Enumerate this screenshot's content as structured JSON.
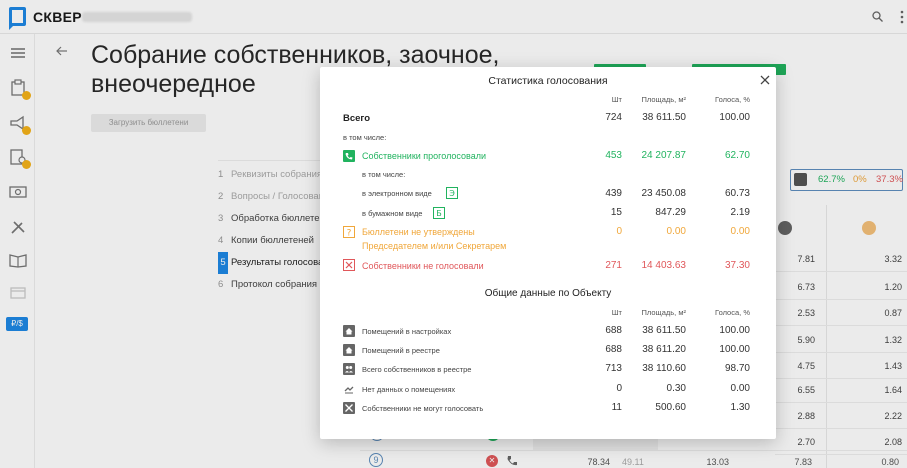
{
  "app": {
    "logo_text": "СКВЕР"
  },
  "page": {
    "title": "Собрание собственников, заочное, внеочередное",
    "upload_button": "Загрузить бюллетени"
  },
  "steps": [
    {
      "num": "1",
      "label": "Реквизиты собрания",
      "state": "muted"
    },
    {
      "num": "2",
      "label": "Вопросы / Голосование",
      "state": "muted"
    },
    {
      "num": "3",
      "label": "Обработка бюллетеней",
      "state": "normal"
    },
    {
      "num": "4",
      "label": "Копии бюллетеней",
      "state": "normal"
    },
    {
      "num": "5",
      "label": "Результаты голосования",
      "state": "active"
    },
    {
      "num": "6",
      "label": "Протокол собрания",
      "state": "normal"
    }
  ],
  "vote_summary": {
    "yes": "62.7%",
    "abstain": "0%",
    "no": "37.3%"
  },
  "background_table": [
    {
      "a": "7.81",
      "b": "3.32"
    },
    {
      "a": "6.73",
      "b": "1.20"
    },
    {
      "a": "2.53",
      "b": "0.87"
    },
    {
      "a": "5.90",
      "b": "1.32"
    },
    {
      "a": "4.75",
      "b": "1.43"
    },
    {
      "a": "6.55",
      "b": "1.64"
    },
    {
      "a": "2.88",
      "b": "2.22"
    },
    {
      "a": "2.70",
      "b": "2.08"
    }
  ],
  "bottom_row": {
    "num": "9",
    "v1": "78.34",
    "v2": "49.11",
    "v3": "13.03",
    "v4": "7.83",
    "v5": "0.80"
  },
  "modal": {
    "title": "Статистика голосования",
    "columns": {
      "count": "Шт",
      "area": "Площадь, м²",
      "votes": "Голоса, %"
    },
    "total": {
      "label": "Всего",
      "count": "724",
      "area": "38 611.50",
      "votes": "100.00"
    },
    "including": "в том числе:",
    "voted": {
      "label": "Собственники проголосовали",
      "count": "453",
      "area": "24 207.87",
      "votes": "62.70"
    },
    "voted_including": "в том числе:",
    "electronic": {
      "label": "в электронном виде",
      "count": "439",
      "area": "23 450.08",
      "votes": "60.73"
    },
    "paper": {
      "label": "в бумажном виде",
      "count": "15",
      "area": "847.29",
      "votes": "2.19"
    },
    "unapproved": {
      "label_line1": "Бюллетени не утверждены",
      "label_line2": "Председателем и/или Секретарем",
      "count": "0",
      "area": "0.00",
      "votes": "0.00"
    },
    "not_voted": {
      "label": "Собственники не голосовали",
      "count": "271",
      "area": "14 403.63",
      "votes": "37.30"
    },
    "object_title": "Общие данные по Объекту",
    "object_columns": {
      "count": "Шт",
      "area": "Площадь, м²",
      "votes": "Голоса, %"
    },
    "object_rows": [
      {
        "label": "Помещений в настройках",
        "count": "688",
        "area": "38 611.50",
        "votes": "100.00",
        "icon": "house-icon"
      },
      {
        "label": "Помещений в реестре",
        "count": "688",
        "area": "38 611.20",
        "votes": "100.00",
        "icon": "house-icon"
      },
      {
        "label": "Всего собственников в реестре",
        "count": "713",
        "area": "38 110.60",
        "votes": "98.70",
        "icon": "people-icon"
      },
      {
        "label": "Нет данных о помещениях",
        "count": "0",
        "area": "0.30",
        "votes": "0.00",
        "icon": "no-data-icon"
      },
      {
        "label": "Собственники не могут голосовать",
        "count": "11",
        "area": "500.60",
        "votes": "1.30",
        "icon": "cannot-vote-icon"
      }
    ]
  },
  "colors": {
    "accent": "#1e88e5",
    "green": "#21b35f",
    "orange": "#f0a73a",
    "red": "#e0575a"
  }
}
